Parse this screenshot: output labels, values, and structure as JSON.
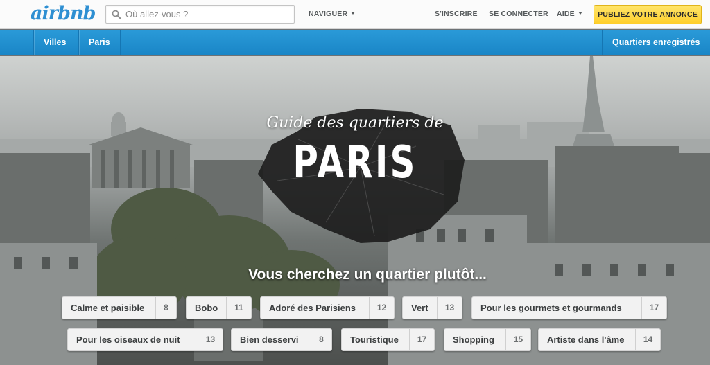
{
  "header": {
    "logo": "airbnb",
    "search_placeholder": "Où allez-vous ?",
    "browse_label": "NAVIGUER",
    "signup_label": "S'INSCRIRE",
    "login_label": "SE CONNECTER",
    "help_label": "AIDE",
    "publish_label": "PUBLIEZ VOTRE ANNONCE"
  },
  "subnav": {
    "breadcrumbs": [
      "Villes",
      "Paris"
    ],
    "saved_label": "Quartiers enregistrés"
  },
  "hero": {
    "subtitle": "Guide des quartiers de",
    "title": "PARIS",
    "question": "Vous cherchez un quartier plutôt..."
  },
  "tags": [
    {
      "label": "Calme et paisible",
      "count": "8"
    },
    {
      "label": "Bobo",
      "count": "11"
    },
    {
      "label": "Adoré des Parisiens",
      "count": "12"
    },
    {
      "label": "Vert",
      "count": "13"
    },
    {
      "label": "Pour les gourmets et gourmands",
      "count": "17"
    },
    {
      "label": "Pour les oiseaux de nuit",
      "count": "13"
    },
    {
      "label": "Bien desservi",
      "count": "8"
    },
    {
      "label": "Touristique",
      "count": "17"
    },
    {
      "label": "Shopping",
      "count": "15"
    },
    {
      "label": "Artiste dans l'âme",
      "count": "14"
    }
  ],
  "colors": {
    "brand_blue": "#2e8fd2",
    "subbar_blue": "#1f8ecf",
    "publish_yellow": "#ffd53f"
  },
  "icons": {
    "search": "search-icon",
    "browse_caret": "caret-down-icon",
    "help_caret": "caret-down-icon",
    "map": "paris-map-icon"
  }
}
